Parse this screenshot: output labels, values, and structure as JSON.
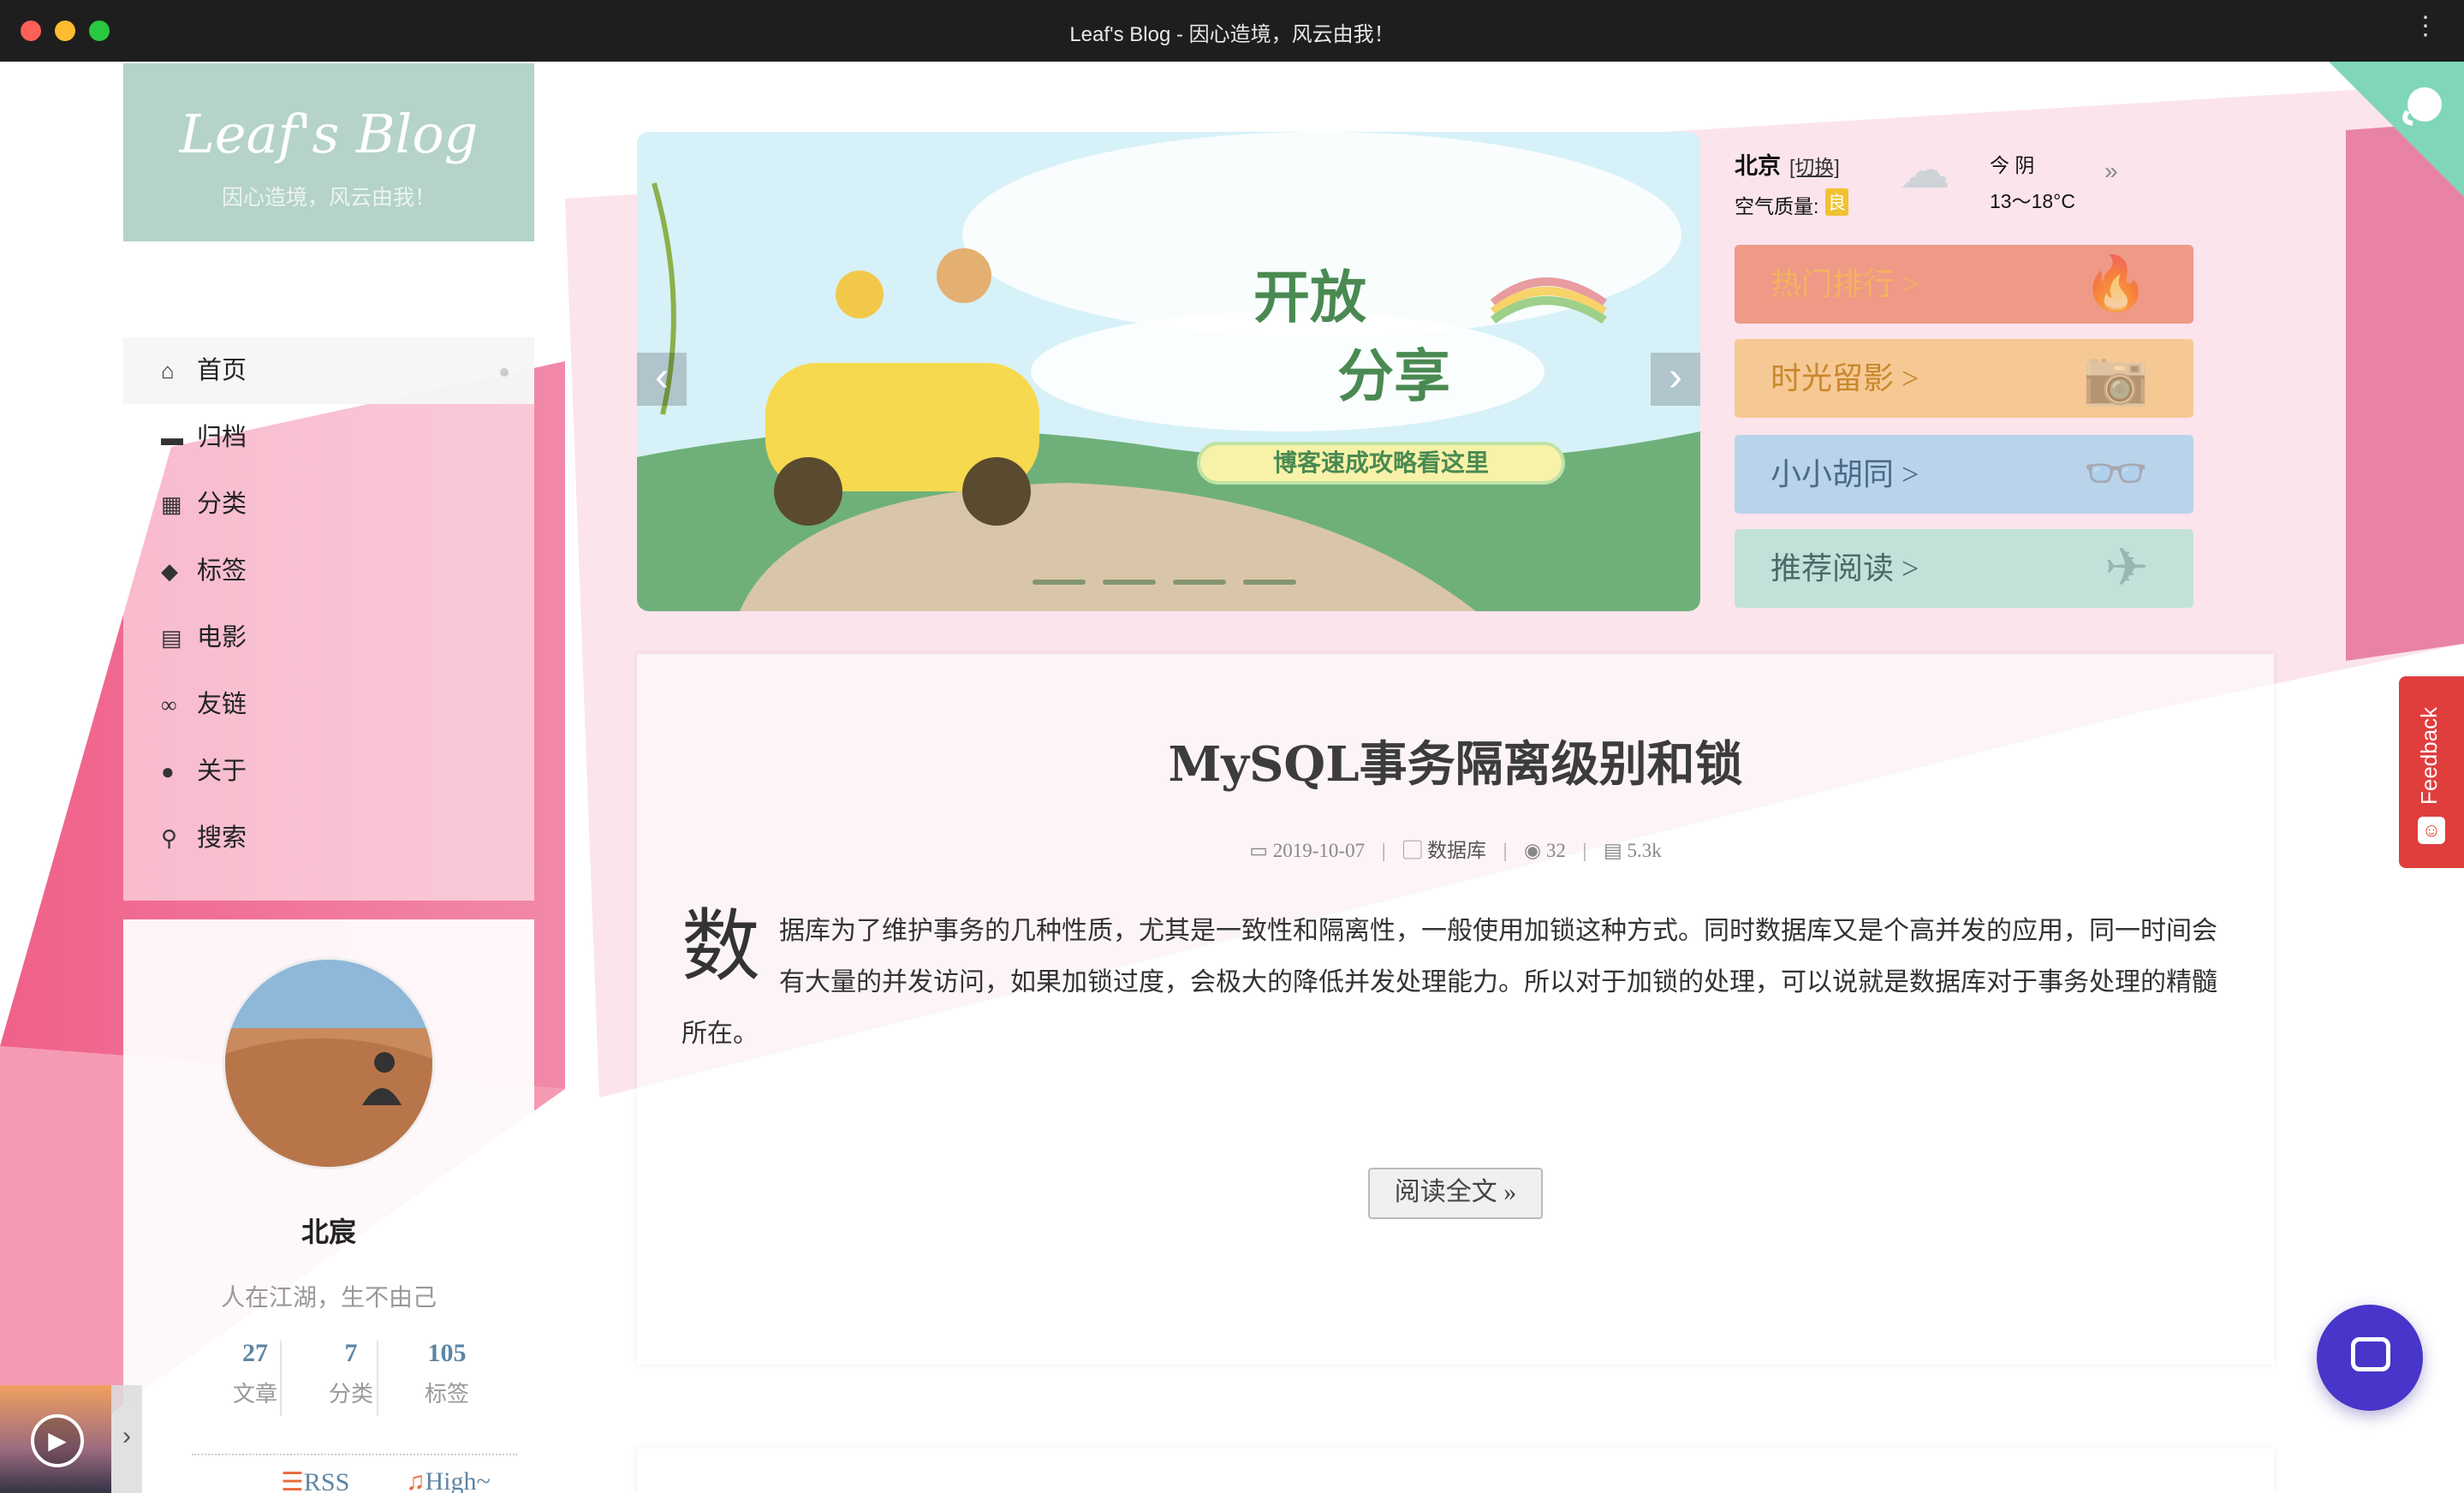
{
  "window": {
    "title": "Leaf's Blog - 因心造境，风云由我！"
  },
  "brand": {
    "name": "Leaf's Blog",
    "subtitle": "因心造境，风云由我！"
  },
  "menu": [
    {
      "label": "首页",
      "icon": "home-icon",
      "glyph": "⌂",
      "active": true
    },
    {
      "label": "归档",
      "icon": "archive-icon",
      "glyph": "▬"
    },
    {
      "label": "分类",
      "icon": "grid-icon",
      "glyph": "▦"
    },
    {
      "label": "标签",
      "icon": "tags-icon",
      "glyph": "◆"
    },
    {
      "label": "电影",
      "icon": "film-icon",
      "glyph": "▤"
    },
    {
      "label": "友链",
      "icon": "link-icon",
      "glyph": "∞"
    },
    {
      "label": "关于",
      "icon": "user-icon",
      "glyph": "●"
    },
    {
      "label": "搜索",
      "icon": "search-icon",
      "glyph": "⚲"
    }
  ],
  "profile": {
    "name": "北宸",
    "motto": "人在江湖，生不由己",
    "stats": [
      {
        "num": "27",
        "label": "文章"
      },
      {
        "num": "7",
        "label": "分类"
      },
      {
        "num": "105",
        "label": "标签"
      }
    ],
    "rss": "RSS",
    "high": "High~"
  },
  "slider": {
    "title_line1": "开放",
    "title_line2": "分享",
    "caption": "博客速成攻略看这里",
    "prev": "‹",
    "next": "›"
  },
  "weather": {
    "city": "北京",
    "switch": "[切换]",
    "air_label": "空气质量:",
    "air_value": "良",
    "today": "今 阴",
    "temp": "13～18°C",
    "more": "»"
  },
  "categories": [
    {
      "label": "热门排行 >",
      "bg": "#ee9a86",
      "color": "#f3b35e",
      "deco": "🔥"
    },
    {
      "label": "时光留影 >",
      "bg": "#f6c894",
      "color": "#c8882c",
      "deco": "📷"
    },
    {
      "label": "小小胡同 >",
      "bg": "#b9d3ea",
      "color": "#4a6a8a",
      "deco": "👓"
    },
    {
      "label": "推荐阅读 >",
      "bg": "#c2e2d9",
      "color": "#4a6a6a",
      "deco": "✈"
    }
  ],
  "post": {
    "title": "MySQL事务隔离级别和锁",
    "date": "2019-10-07",
    "category": "数据库",
    "views": "32",
    "words": "5.3k",
    "dropcap": "数",
    "excerpt": "据库为了维护事务的几种性质，尤其是一致性和隔离性，一般使用加锁这种方式。同时数据库又是个高并发的应用，同一时间会有大量的并发访问，如果加锁过度，会极大的降低并发处理能力。所以对于加锁的处理，可以说就是数据库对于事务处理的精髓所在。",
    "read_more": "阅读全文 »"
  },
  "feedback": {
    "label": "Feedback"
  },
  "colors": {
    "accent_pink": "#f06a8c",
    "brand_bg": "#b5d3ca",
    "chat": "#4835c9",
    "feedback": "#e03d3d"
  }
}
